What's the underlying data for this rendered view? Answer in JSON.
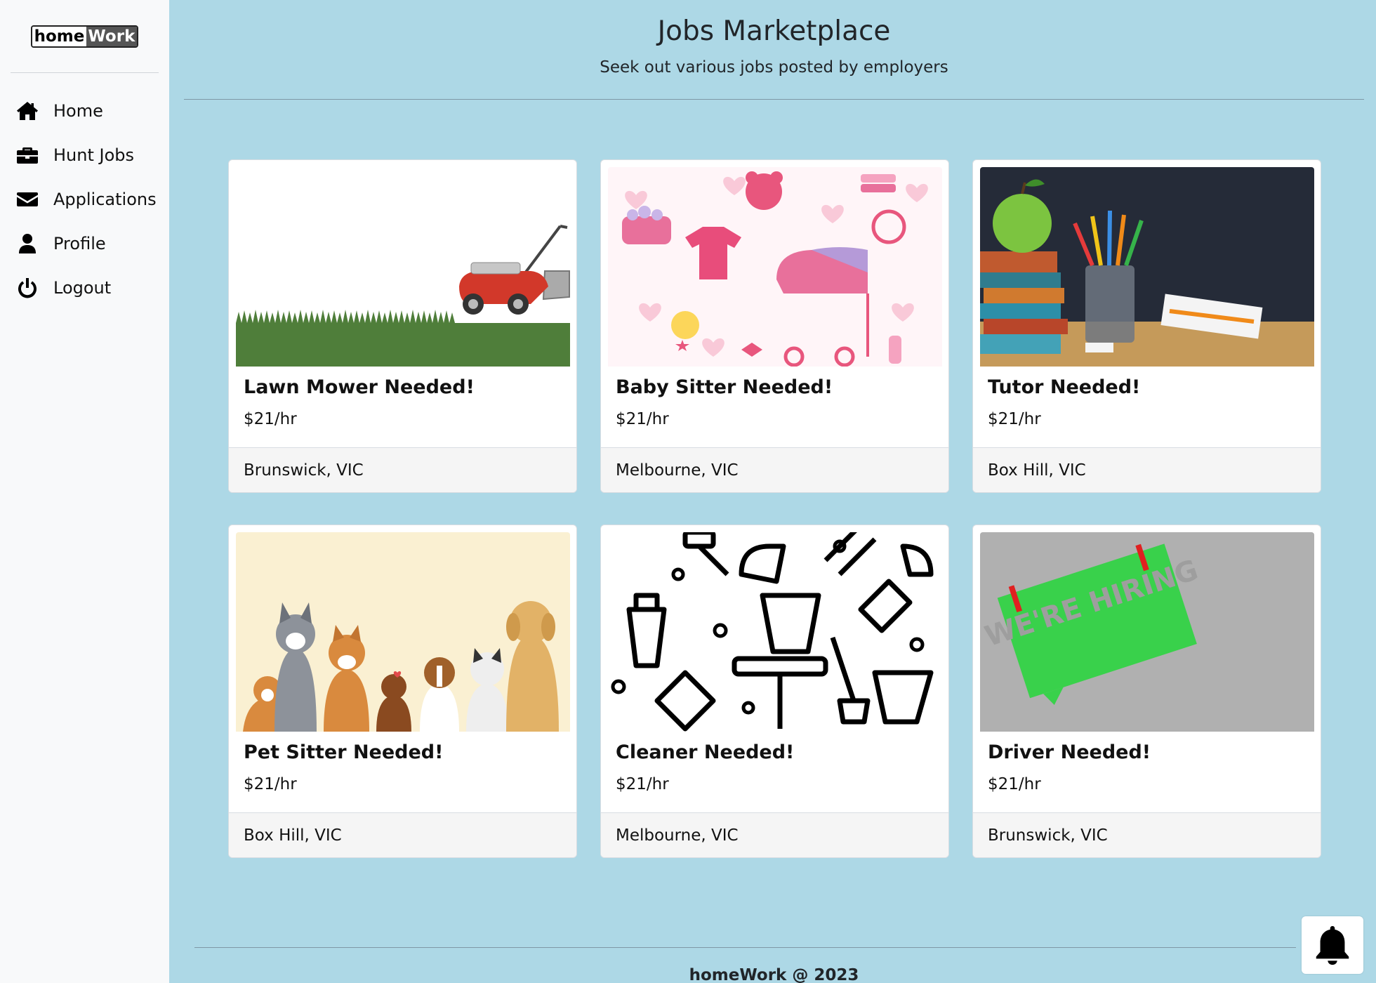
{
  "brand": {
    "part1": "home",
    "part2": "Work"
  },
  "sidebar": {
    "items": [
      {
        "label": "Home",
        "icon": "home-icon"
      },
      {
        "label": "Hunt Jobs",
        "icon": "briefcase-icon"
      },
      {
        "label": "Applications",
        "icon": "envelope-icon"
      },
      {
        "label": "Profile",
        "icon": "user-icon"
      },
      {
        "label": "Logout",
        "icon": "power-icon"
      }
    ]
  },
  "header": {
    "title": "Jobs Marketplace",
    "subtitle": "Seek out various jobs posted by employers"
  },
  "jobs": [
    {
      "title": "Lawn Mower Needed!",
      "rate": "$21/hr",
      "location": "Brunswick, VIC",
      "image": "lawn-mower-image"
    },
    {
      "title": "Baby Sitter Needed!",
      "rate": "$21/hr",
      "location": "Melbourne, VIC",
      "image": "baby-pattern-image"
    },
    {
      "title": "Tutor Needed!",
      "rate": "$21/hr",
      "location": "Box Hill, VIC",
      "image": "school-supplies-image"
    },
    {
      "title": "Pet Sitter Needed!",
      "rate": "$21/hr",
      "location": "Box Hill, VIC",
      "image": "dogs-image"
    },
    {
      "title": "Cleaner Needed!",
      "rate": "$21/hr",
      "location": "Melbourne, VIC",
      "image": "cleaning-pattern-image"
    },
    {
      "title": "Driver Needed!",
      "rate": "$21/hr",
      "location": "Brunswick, VIC",
      "image": "were-hiring-image",
      "image_text": "WE'RE HIRING"
    }
  ],
  "footer": {
    "text": "homeWork @ 2023"
  },
  "colors": {
    "background": "#add8e6",
    "sidebar": "#f8f9fa",
    "card_footer": "#f5f5f5"
  },
  "notification": {
    "icon": "bell-icon"
  }
}
